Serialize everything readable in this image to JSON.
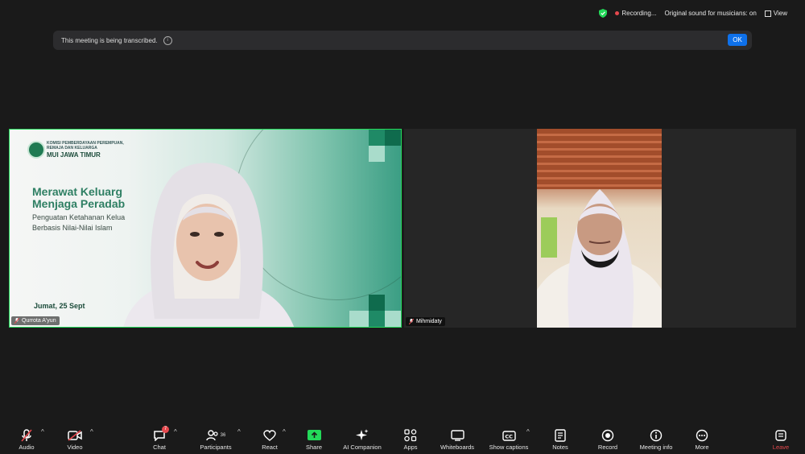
{
  "top_right": {
    "recording_label": "Recording...",
    "original_sound": "Original sound for musicians: on",
    "view_label": "View"
  },
  "banner": {
    "text": "This meeting is being transcribed.",
    "ok_label": "OK"
  },
  "tiles": [
    {
      "name": "Qurrota A'yun",
      "slide": {
        "org_line1": "KOMISI PEMBERDAYAAN PEREMPUAN,",
        "org_line2": "REMAJA DAN KELUARGA",
        "org_name": "MUI JAWA TIMUR",
        "title_line1": "Merawat Keluarg",
        "title_line2": "Menjaga Peradab",
        "subtitle_line1": "Penguatan Ketahanan Kelua",
        "subtitle_line2": "Berbasis Nilai-Nilai Islam",
        "date": "Jumat, 25 Sept"
      }
    },
    {
      "name": "Mihmidaty"
    }
  ],
  "toolbar": {
    "audio": "Audio",
    "video": "Video",
    "chat": "Chat",
    "chat_badge": "7",
    "participants": "Participants",
    "participants_count": "36",
    "react": "React",
    "share": "Share",
    "ai_companion": "AI Companion",
    "apps": "Apps",
    "whiteboards": "Whiteboards",
    "show_captions": "Show captions",
    "notes": "Notes",
    "record": "Record",
    "meeting_info": "Meeting info",
    "more": "More",
    "leave": "Leave"
  },
  "colors": {
    "background": "#1a1a1a",
    "active_speaker_border": "#23d959",
    "ok_button": "#0e71eb",
    "share_green": "#23d959",
    "alert_red": "#e5484d"
  }
}
